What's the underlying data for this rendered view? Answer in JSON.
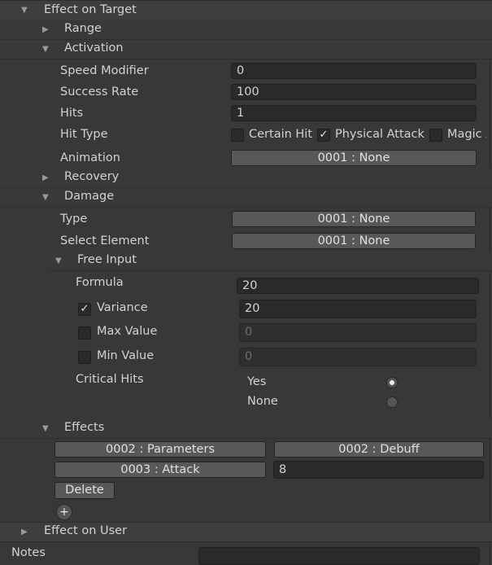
{
  "sections": {
    "effect_on_target": "Effect on Target",
    "range": "Range",
    "activation": "Activation",
    "recovery": "Recovery",
    "damage": "Damage",
    "free_input": "Free Input",
    "effects": "Effects",
    "effect_on_user": "Effect on User"
  },
  "activation": {
    "speed_modifier_label": "Speed Modifier",
    "speed_modifier_value": "0",
    "success_rate_label": "Success Rate",
    "success_rate_value": "100",
    "hits_label": "Hits",
    "hits_value": "1",
    "hit_type_label": "Hit Type",
    "hit_types": [
      {
        "label": "Certain Hit",
        "checked": false
      },
      {
        "label": "Physical Attack",
        "checked": true
      },
      {
        "label": "Magic A",
        "checked": false
      }
    ],
    "animation_label": "Animation",
    "animation_value": "0001 : None"
  },
  "damage": {
    "type_label": "Type",
    "type_value": "0001 : None",
    "element_label": "Select Element",
    "element_value": "0001 : None",
    "formula_label": "Formula",
    "formula_value": "20",
    "variance_label": "Variance",
    "variance_checked": true,
    "variance_value": "20",
    "max_label": "Max Value",
    "max_checked": false,
    "max_value": "0",
    "min_label": "Min Value",
    "min_checked": false,
    "min_value": "0",
    "critical_label": "Critical Hits",
    "critical_options": [
      {
        "label": "Yes",
        "selected": true
      },
      {
        "label": "None",
        "selected": false
      }
    ]
  },
  "effects": {
    "row1_left": "0002 : Parameters",
    "row1_right": "0002 : Debuff",
    "row2_left": "0003 : Attack",
    "row2_value": "8",
    "delete_label": "Delete",
    "add_label": "+"
  },
  "notes": {
    "label": "Notes",
    "value": ""
  },
  "icons": {
    "expanded": "▼",
    "collapsed": "▶",
    "check": "✓"
  }
}
